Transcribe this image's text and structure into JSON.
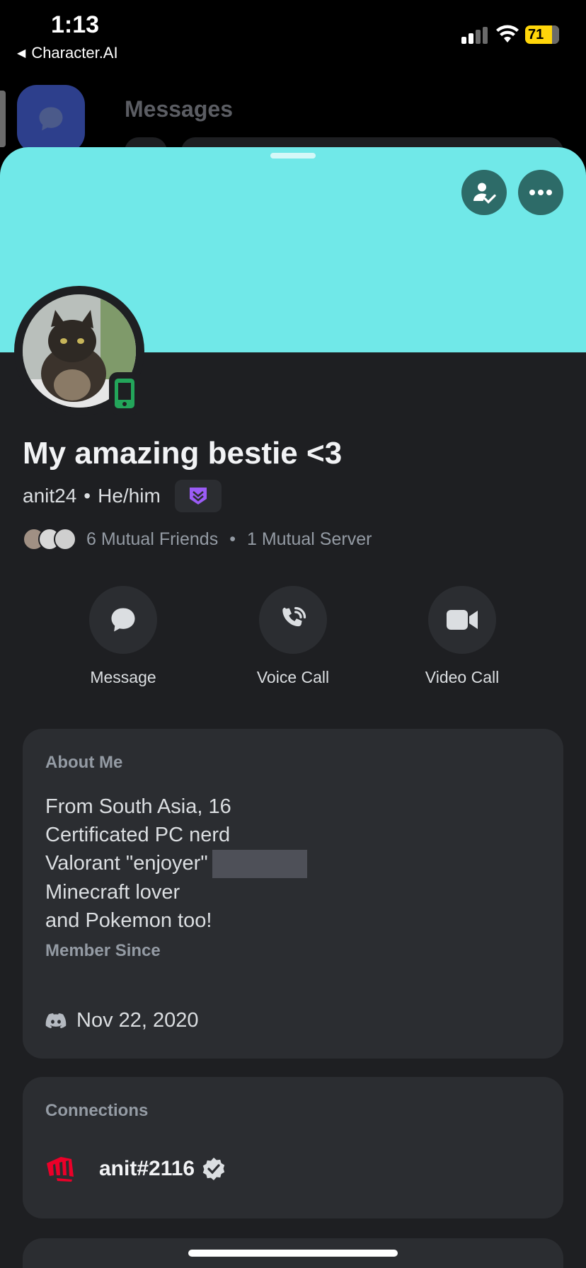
{
  "status_bar": {
    "time": "1:13",
    "back_app": "Character.AI",
    "battery": "71"
  },
  "background": {
    "title": "Messages"
  },
  "profile": {
    "display_name": "My amazing bestie <3",
    "username": "anit24",
    "pronouns": "He/him",
    "mutual_friends": "6 Mutual Friends",
    "mutual_servers": "1 Mutual Server"
  },
  "actions": {
    "message": "Message",
    "voice_call": "Voice Call",
    "video_call": "Video Call"
  },
  "about": {
    "title": "About Me",
    "lines": [
      "From South Asia, 16",
      "Certificated PC nerd",
      "Valorant \"enjoyer\"",
      "Minecraft lover",
      "and Pokemon too!"
    ],
    "member_since_title": "Member Since",
    "member_since": "Nov 22, 2020"
  },
  "connections": {
    "title": "Connections",
    "account": "anit#2116"
  },
  "colors": {
    "banner": "#70e8e8",
    "online_mobile": "#23a55a",
    "badge": "#9b5cf6"
  }
}
